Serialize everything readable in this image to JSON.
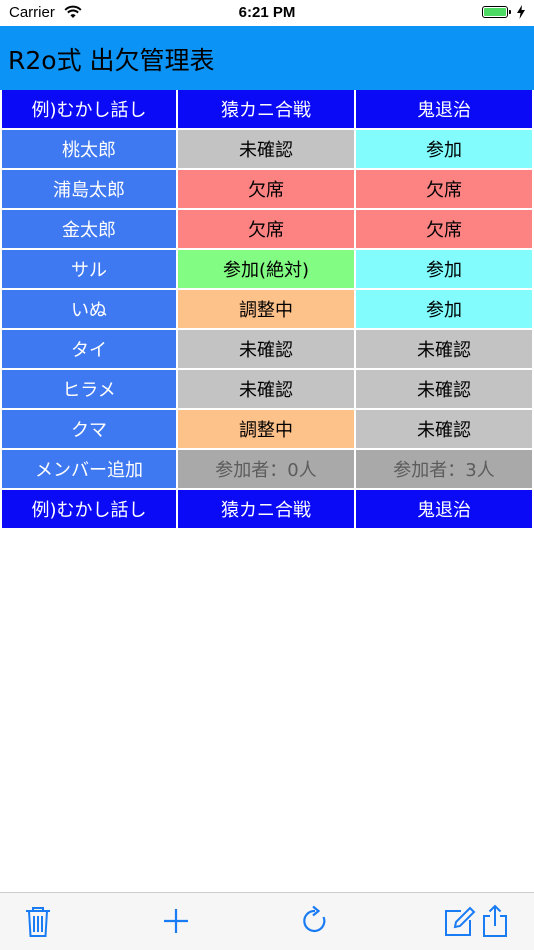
{
  "status_bar": {
    "carrier": "Carrier",
    "time": "6:21 PM"
  },
  "header": {
    "title": "R2o式 出欠管理表"
  },
  "table": {
    "events": [
      "猿カニ合戦",
      "鬼退治"
    ],
    "header_label": "例)むかし話し",
    "rows": [
      {
        "name": "桃太郎",
        "cells": [
          {
            "text": "未確認",
            "color": "#c3c3c3"
          },
          {
            "text": "参加",
            "color": "#82fcfc"
          }
        ]
      },
      {
        "name": "浦島太郎",
        "cells": [
          {
            "text": "欠席",
            "color": "#fd8282"
          },
          {
            "text": "欠席",
            "color": "#fd8282"
          }
        ]
      },
      {
        "name": "金太郎",
        "cells": [
          {
            "text": "欠席",
            "color": "#fd8282"
          },
          {
            "text": "欠席",
            "color": "#fd8282"
          }
        ]
      },
      {
        "name": "サル",
        "cells": [
          {
            "text": "参加(絶対)",
            "color": "#82fc82"
          },
          {
            "text": "参加",
            "color": "#82fcfc"
          }
        ]
      },
      {
        "name": "いぬ",
        "cells": [
          {
            "text": "調整中",
            "color": "#fdc18a"
          },
          {
            "text": "参加",
            "color": "#82fcfc"
          }
        ]
      },
      {
        "name": "タイ",
        "cells": [
          {
            "text": "未確認",
            "color": "#c3c3c3"
          },
          {
            "text": "未確認",
            "color": "#c3c3c3"
          }
        ]
      },
      {
        "name": "ヒラメ",
        "cells": [
          {
            "text": "未確認",
            "color": "#c3c3c3"
          },
          {
            "text": "未確認",
            "color": "#c3c3c3"
          }
        ]
      },
      {
        "name": "クマ",
        "cells": [
          {
            "text": "調整中",
            "color": "#fdc18a"
          },
          {
            "text": "未確認",
            "color": "#c3c3c3"
          }
        ]
      }
    ],
    "add_member_label": "メンバー追加",
    "counts": [
      "参加者：0人",
      "参加者：3人"
    ]
  },
  "toolbar": {
    "icons": [
      "trash-icon",
      "plus-icon",
      "refresh-icon",
      "compose-icon",
      "share-icon"
    ],
    "tint": "#1a7cf5"
  }
}
